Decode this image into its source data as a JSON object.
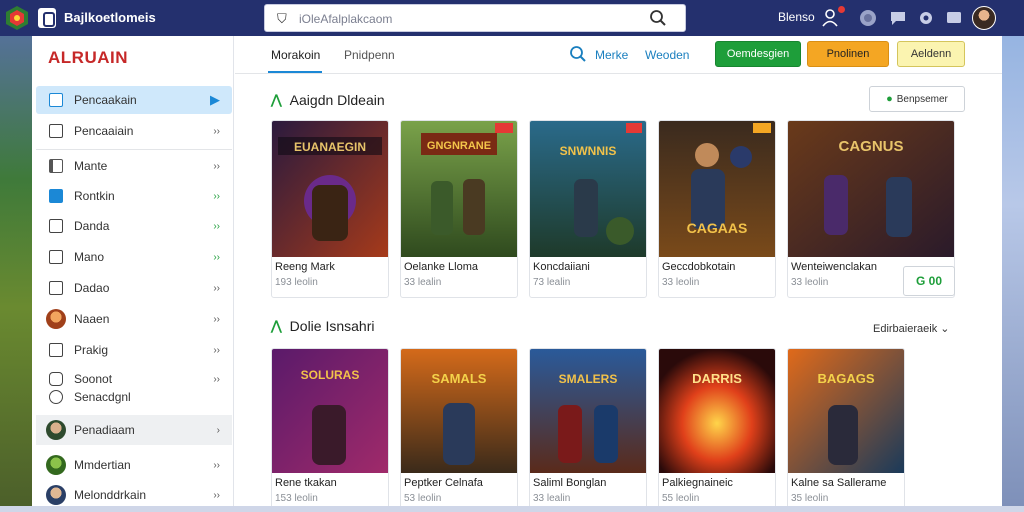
{
  "topbar": {
    "site_name": "Bajlkoetlomeis",
    "url": "iOleAfalplakcaom",
    "right_label": "Blenso"
  },
  "sidebar": {
    "brand": "ALRUAIN",
    "items": [
      {
        "label": "Pencaakain",
        "arrow": "▶"
      },
      {
        "label": "Pencaaiain",
        "arrow": "››"
      },
      {
        "label": "Mante",
        "arrow": "››"
      },
      {
        "label": "Rontkin",
        "arrow": "››"
      },
      {
        "label": "Danda",
        "arrow": "››"
      },
      {
        "label": "Mano",
        "arrow": "››"
      },
      {
        "label": "Dadao",
        "arrow": "››"
      },
      {
        "label": "Naaen",
        "arrow": "››"
      },
      {
        "label": "Prakig",
        "arrow": "››"
      },
      {
        "label": "Soonot",
        "arrow": "››"
      },
      {
        "label": "Senacdgnl",
        "arrow": ""
      },
      {
        "label": "Penadiaam",
        "arrow": "›"
      },
      {
        "label": "Mmdertian",
        "arrow": "››"
      },
      {
        "label": "Melonddrkain",
        "arrow": "››"
      }
    ]
  },
  "tabs": [
    {
      "label": "Morakoin"
    },
    {
      "label": "Pnidpenn"
    }
  ],
  "header": {
    "link_1": "Merke",
    "link_2": "Weoden",
    "btn_green": "Oemdesgien",
    "btn_orange": "Pnolinen",
    "btn_yellow": "Aeldenn"
  },
  "section_1": {
    "title": "Aaigdn Dldeain",
    "button": "Benpsemer"
  },
  "section_2": {
    "title": "Dolie Isnsahri",
    "sort": "Edirbaieraeik"
  },
  "row_1": [
    {
      "title": "Reeng Mark",
      "sub": "193 leolin",
      "art_text": "EUANAEGIN"
    },
    {
      "title": "Oelanke Lloma",
      "sub": "33 lealin",
      "art_text": "GNGNRANE"
    },
    {
      "title": "Koncdaiiani",
      "sub": "73 lealin",
      "art_text": "SNWNNIS"
    },
    {
      "title": "Geccdobkotain",
      "sub": "33 leolin",
      "art_text": "CAGAAS"
    },
    {
      "title": "Wenteiwenclakan",
      "sub": "33 leolin",
      "art_text": "CAGNUS"
    }
  ],
  "price_tag": "G 00",
  "row_2": [
    {
      "title": "Rene tkakan",
      "sub": "153 leolin",
      "art_text": "SOLURAS"
    },
    {
      "title": "Peptker Celnafa",
      "sub": "53 leolin",
      "art_text": "SAMALS"
    },
    {
      "title": "Saliml Bonglan",
      "sub": "33 lealin",
      "art_text": "SMALERS"
    },
    {
      "title": "Palkiegnaineic",
      "sub": "55 leolin",
      "art_text": "DARRIS"
    },
    {
      "title": "Kalne sa Sallerame",
      "sub": "35 leolin",
      "art_text": "BAGAGS"
    }
  ],
  "colors": {
    "accent_blue": "#1b88d6",
    "green": "#1e9e3a",
    "orange": "#f4a623",
    "brand_red": "#c62828",
    "topbar": "#24306e"
  }
}
